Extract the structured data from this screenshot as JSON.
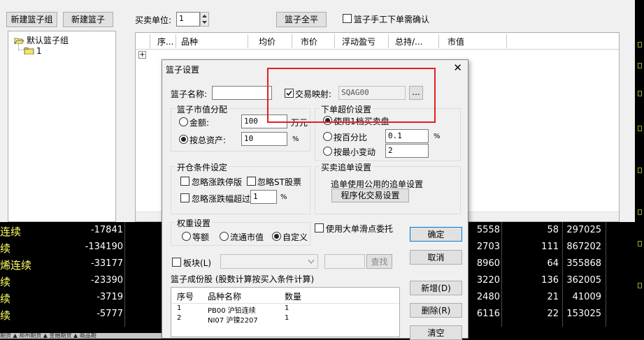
{
  "window": {
    "new_group_button": "新建篮子组",
    "new_basket_button": "新建篮子",
    "trade_unit_label": "买卖单位:",
    "trade_unit_value": "1",
    "flatten_all_button": "篮子全平",
    "manual_confirm_label": "篮子手工下单需确认"
  },
  "tree": {
    "default_group": "默认篮子组",
    "basket_1": "1"
  },
  "grid": {
    "columns": [
      "序...",
      "品种",
      "均价",
      "市价",
      "浮动盈亏",
      "总持/...",
      "市值"
    ],
    "expand_symbol": "+"
  },
  "dialog": {
    "title": "篮子设置",
    "close_symbol": "✕",
    "basket_name_label": "篮子名称:",
    "basket_name_value": "",
    "trade_mapping_label": "交易映射:",
    "trade_mapping_checked": true,
    "trade_mapping_value": "SQAG00",
    "browse_button": "...",
    "market_value_group": "篮子市值分配",
    "amount_label": "金额:",
    "amount_value": "100",
    "amount_unit": "万元",
    "total_assets_label": "按总资产:",
    "total_assets_value": "10",
    "total_assets_unit": "%",
    "order_price_group": "下单超价设置",
    "use_level1_label": "使用1档买卖盘",
    "percent_label": "按百分比",
    "percent_value": "0.1",
    "percent_unit": "%",
    "min_tick_label": "按最小变动",
    "min_tick_value": "2",
    "open_cond_group": "开仓条件设定",
    "ignore_limit_label": "忽略涨跌停版",
    "ignore_st_label": "忽略ST股票",
    "ignore_exceed_label": "忽略涨跌幅超过",
    "ignore_exceed_value": "1",
    "ignore_exceed_unit": "%",
    "follow_group": "买卖追单设置",
    "follow_text": "追单使用公用的追单设置",
    "program_button": "程序化交易设置",
    "weight_group": "权重设置",
    "equal_label": "等额",
    "float_cap_label": "流通市值",
    "custom_label": "自定义",
    "large_slip_label": "使用大单滑点委托",
    "ok_button": "确定",
    "cancel_button": "取消",
    "sector_label": "板块(L)",
    "search_button": "查找",
    "members_label": "篮子成份股 (股数计算按买入条件计算)",
    "add_button": "新增(D)",
    "delete_button": "删除(R)",
    "clear_button": "清空",
    "member_columns": [
      "序号",
      "品种名称",
      "数量"
    ],
    "members": [
      {
        "no": "1",
        "name": "PB00 沪铅连续",
        "qty": "1"
      },
      {
        "no": "2",
        "name": "NI07 沪镍2207",
        "qty": "1"
      }
    ]
  },
  "background_rows": [
    {
      "name": "连续",
      "value": "-17841",
      "c1": "5558",
      "c2": "58",
      "c3": "297025"
    },
    {
      "name": "续",
      "value": "-134190",
      "c1": "2703",
      "c2": "111",
      "c3": "867202"
    },
    {
      "name": "烯连续",
      "value": "-33177",
      "c1": "8960",
      "c2": "64",
      "c3": "355868"
    },
    {
      "name": "续",
      "value": "-23390",
      "c1": "3220",
      "c2": "136",
      "c3": "362005"
    },
    {
      "name": "续",
      "value": "-3719",
      "c1": "2480",
      "c2": "21",
      "c3": "41009"
    },
    {
      "name": "续",
      "value": "-5777",
      "c1": "6116",
      "c2": "22",
      "c3": "153025"
    }
  ],
  "bottom_tabs": "期货 ▲ 郑州期货 ▲ 金融期货 ▲ 商品期",
  "colors": {
    "highlight_box": "#e02020",
    "quote_name": "#ffff66",
    "quote_value": "#ffffff"
  }
}
